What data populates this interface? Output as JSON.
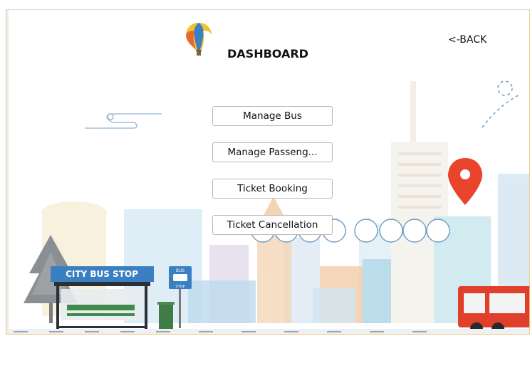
{
  "header": {
    "title": "DASHBOARD",
    "back_label": "<-BACK"
  },
  "menu": {
    "items": [
      {
        "label": "Manage Bus"
      },
      {
        "label": "Manage Passeng..."
      },
      {
        "label": "Ticket Booking"
      },
      {
        "label": "Ticket Cancellation"
      }
    ]
  },
  "scene": {
    "bus_stop_sign": "CITY BUS STOP",
    "bus_sign_top": "BUS",
    "bus_sign_bottom": "STOP"
  },
  "colors": {
    "accent_red": "#e8452c",
    "sign_blue": "#3a7fc1",
    "bench_green": "#3f8a4c",
    "window_border": "#f0c27a"
  },
  "icons": [
    "balloon-icon",
    "location-pin-icon"
  ]
}
